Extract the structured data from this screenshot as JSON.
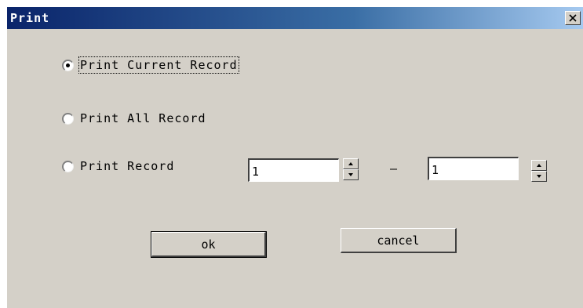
{
  "window": {
    "title": "Print",
    "close_label": "×"
  },
  "options": [
    {
      "label": "Print Current Record",
      "selected": true
    },
    {
      "label": "Print All Record",
      "selected": false
    },
    {
      "label": "Print Record",
      "selected": false
    }
  ],
  "range": {
    "from_value": "1",
    "separator": "–",
    "to_value": "1"
  },
  "buttons": {
    "ok_label": "ok",
    "cancel_label": "cancel"
  },
  "icons": {
    "close": "close-icon",
    "spin_up": "chevron-up-icon",
    "spin_down": "chevron-down-icon"
  }
}
